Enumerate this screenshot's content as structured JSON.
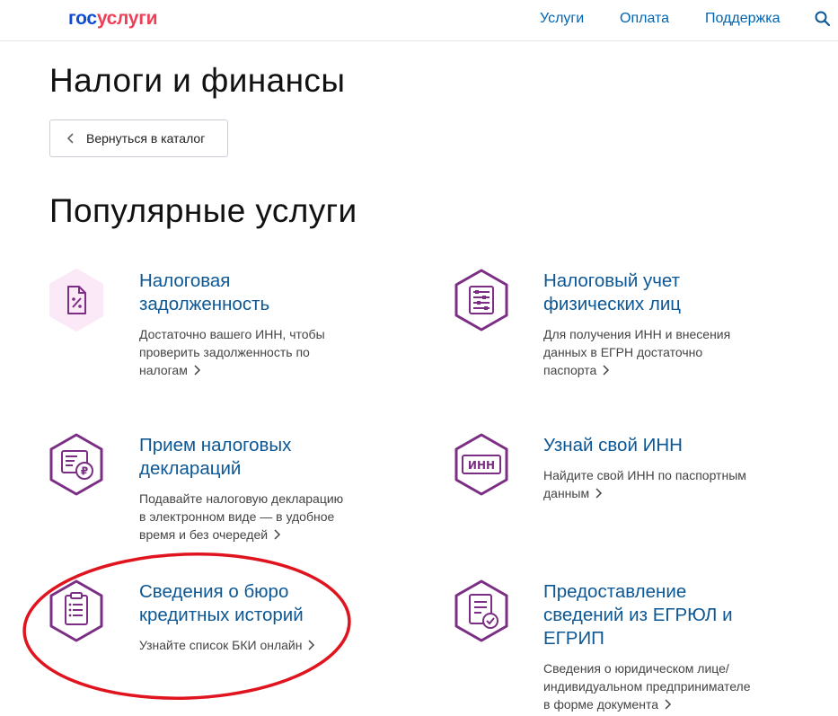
{
  "header": {
    "logo_part1": "гос",
    "logo_part2": "услуги",
    "nav": [
      "Услуги",
      "Оплата",
      "Поддержка"
    ]
  },
  "page": {
    "title": "Налоги и финансы",
    "back_label": "Вернуться в каталог",
    "section_title": "Популярные услуги"
  },
  "cards": [
    {
      "title_lines": [
        "Налоговая",
        "задолженность"
      ],
      "desc_lines": [
        "Достаточно вашего ИНН, чтобы",
        "проверить задолженность по",
        "налогам"
      ],
      "icon": "tax-debt-icon"
    },
    {
      "title_lines": [
        "Налоговый учет",
        "физических лиц"
      ],
      "desc_lines": [
        "Для получения ИНН и внесения",
        "данных в ЕГРН достаточно",
        "паспорта"
      ],
      "icon": "abacus-icon"
    },
    {
      "title_lines": [
        "Прием налоговых",
        "деклараций"
      ],
      "desc_lines": [
        "Подавайте налоговую декларацию",
        "в электронном виде — в удобное",
        "время и без очередей"
      ],
      "icon": "tax-declaration-icon"
    },
    {
      "title_lines": [
        "Узнай свой ИНН"
      ],
      "desc_lines": [
        "Найдите свой ИНН по паспортным",
        "данным"
      ],
      "icon": "inn-icon",
      "icon_text": "ИНН"
    },
    {
      "title_lines": [
        "Сведения о бюро",
        "кредитных историй"
      ],
      "desc_lines": [
        "Узнайте список БКИ онлайн"
      ],
      "icon": "clipboard-list-icon"
    },
    {
      "title_lines": [
        "Предоставление",
        "сведений из ЕГРЮЛ и",
        "ЕГРИП"
      ],
      "desc_lines": [
        "Сведения о юридическом лице/",
        "индивидуальном предпринимателе",
        "в форме документа"
      ],
      "icon": "document-check-icon"
    }
  ],
  "colors": {
    "accent_purple": "#7b2e83",
    "link_blue": "#0c5794",
    "highlight_red": "#e0141e"
  }
}
